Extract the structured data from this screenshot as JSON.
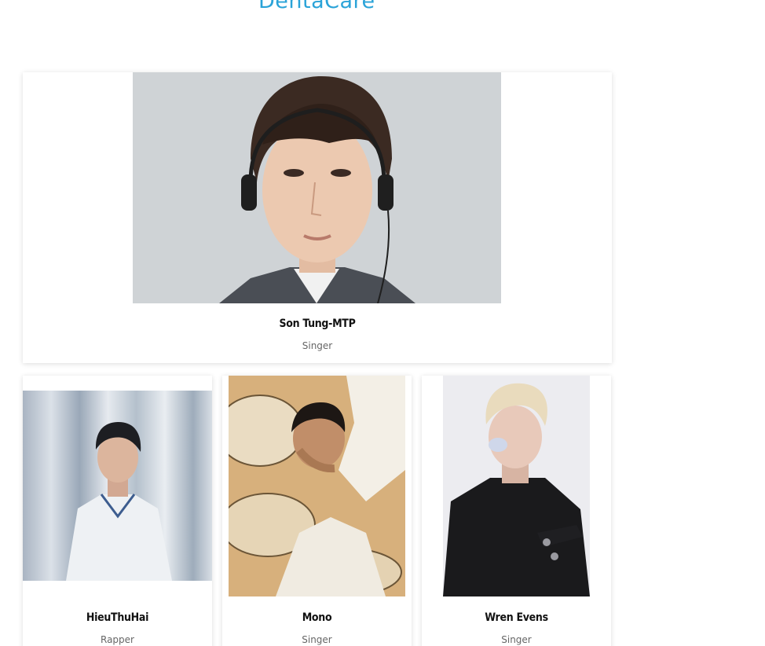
{
  "brand": {
    "title": "DentaCare",
    "color": "#2aa3d8"
  },
  "featured": {
    "name": "Son Tung-MTP",
    "role": "Singer",
    "image_alt": "portrait-photo"
  },
  "team": [
    {
      "name": "HieuThuHai",
      "role": "Rapper",
      "image_alt": "portrait-photo"
    },
    {
      "name": "Mono",
      "role": "Singer",
      "image_alt": "portrait-photo"
    },
    {
      "name": "Wren Evens",
      "role": "Singer",
      "image_alt": "portrait-photo"
    }
  ]
}
